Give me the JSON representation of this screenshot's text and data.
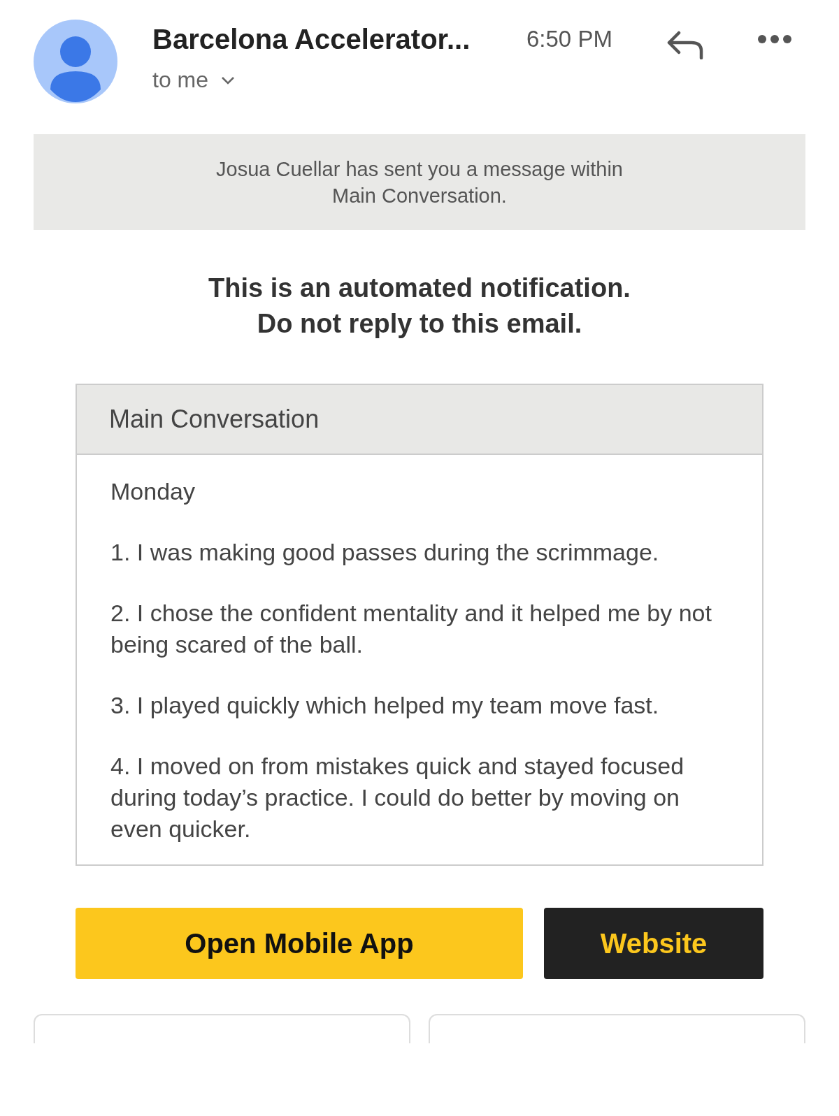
{
  "header": {
    "sender": "Barcelona Accelerator...",
    "time": "6:50 PM",
    "recipient": "to me"
  },
  "banner": "Josua Cuellar has sent you a message within Main Conversation.",
  "notice": [
    "This is an automated notification.",
    "Do not reply to this email."
  ],
  "conversation": {
    "title": "Main Conversation",
    "day": "Monday",
    "items": [
      "1. I was making good passes during the scrimmage.",
      "2. I chose the confident mentality and it helped me by not being scared of the ball.",
      "3. I played quickly which helped my team move fast.",
      "4. I moved on from mistakes quick and stayed focused during today’s practice. I could do better by moving on even quicker."
    ]
  },
  "buttons": [
    {
      "label": "Open Mobile App",
      "kind": "primary"
    },
    {
      "label": "Website",
      "kind": "dark"
    }
  ]
}
